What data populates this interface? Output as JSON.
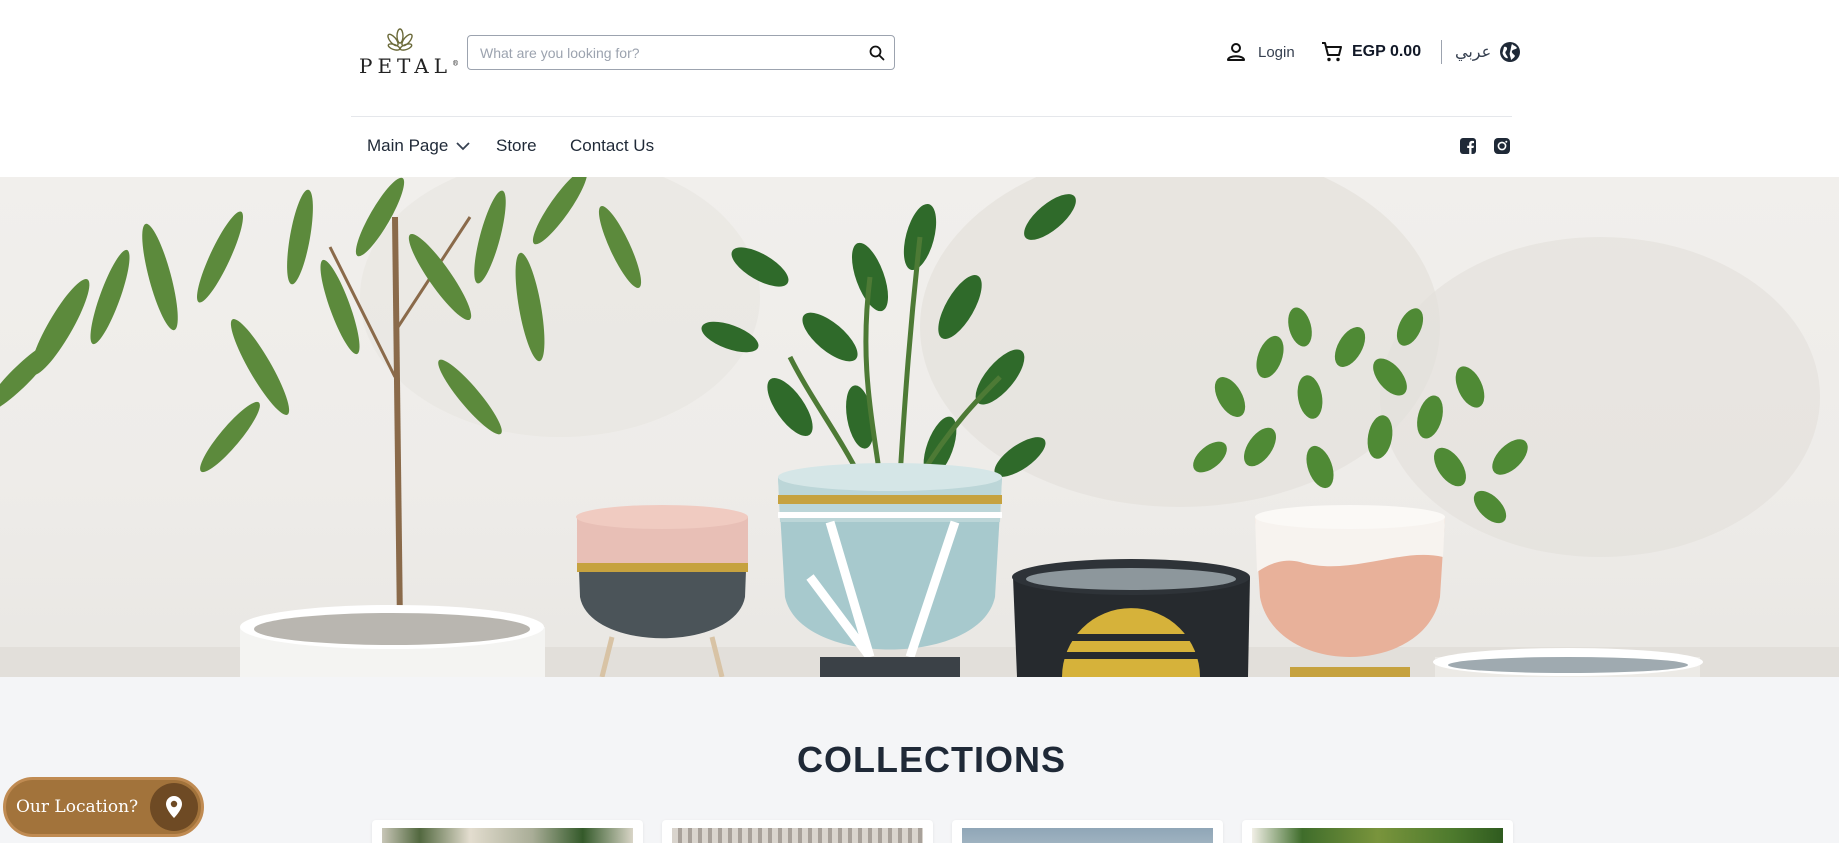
{
  "header": {
    "logo_text": "PETAL",
    "logo_mark": "®",
    "search": {
      "placeholder": "What are you looking for?",
      "value": ""
    },
    "login_label": "Login",
    "cart_total": "EGP 0.00",
    "language_label": "عربي"
  },
  "nav": {
    "items": [
      {
        "label": "Main Page",
        "has_dropdown": true
      },
      {
        "label": "Store"
      },
      {
        "label": "Contact Us"
      }
    ],
    "social": [
      "facebook-icon",
      "instagram-icon"
    ]
  },
  "collections": {
    "title": "COLLECTIONS"
  },
  "location_button": {
    "label": "Our Location?"
  },
  "colors": {
    "accent_brown": "#a2733b",
    "dark_brown": "#6e4a24",
    "page_bg": "#f4f5f7"
  },
  "icons": {
    "search": "search-icon",
    "user": "user-icon",
    "cart": "cart-icon",
    "globe": "globe-icon",
    "chevron": "chevron-down-icon",
    "pin": "map-pin-icon"
  }
}
